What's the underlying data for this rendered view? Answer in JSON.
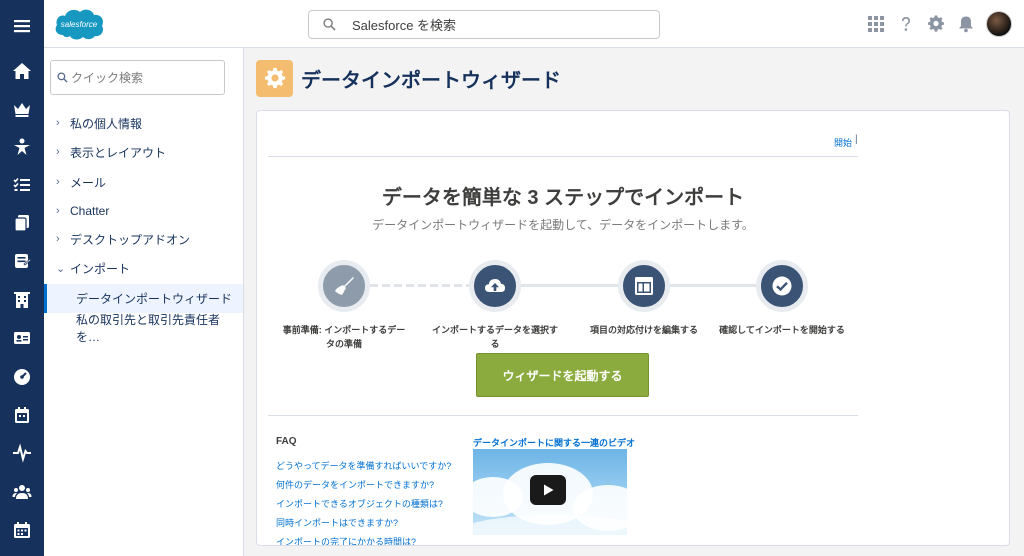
{
  "app": {
    "logo_text": "salesforce"
  },
  "rail": {
    "items": [
      "menu-icon",
      "home-icon",
      "crown-icon",
      "star-person-icon",
      "task-list-icon",
      "copy-icon",
      "contract-icon",
      "building-icon",
      "contact-card-icon",
      "dashboard-icon",
      "calendar-check-icon",
      "pulse-icon",
      "people-icon",
      "calendar-icon"
    ]
  },
  "search": {
    "placeholder": "Salesforce を検索"
  },
  "sidebar": {
    "quick_find_placeholder": "クイック検索",
    "items": [
      {
        "label": "私の個人情報",
        "expanded": false
      },
      {
        "label": "表示とレイアウト",
        "expanded": false
      },
      {
        "label": "メール",
        "expanded": false
      },
      {
        "label": "Chatter",
        "expanded": false
      },
      {
        "label": "デスクトップアドオン",
        "expanded": false
      },
      {
        "label": "インポート",
        "expanded": true
      }
    ],
    "sub_items": [
      {
        "label": "データインポートウィザード",
        "active": true
      },
      {
        "label": "私の取引先と取引先責任者を…",
        "active": false
      }
    ]
  },
  "page": {
    "title": "データインポートウィザード",
    "icon_color": "#f4bc6f"
  },
  "card": {
    "help_link": "開始",
    "hero_title": "データを簡単な 3 ステップでインポート",
    "hero_subtitle": "データインポートウィザードを起動して、データをインポートします。",
    "steps": [
      {
        "label": "事前準備: インポートするデータの準備",
        "icon": "broom-icon"
      },
      {
        "label": "インポートするデータを選択する",
        "icon": "cloud-upload-icon"
      },
      {
        "label": "項目の対応付けを編集する",
        "icon": "layout-icon"
      },
      {
        "label": "確認してインポートを開始する",
        "icon": "check-icon"
      }
    ],
    "launch_button": "ウィザードを起動する",
    "launch_button_color": "#8cab3e",
    "faq": {
      "title": "FAQ",
      "links": [
        "どうやってデータを準備すればいいですか?",
        "何件のデータをインポートできますか?",
        "インポートできるオブジェクトの種類は?",
        "同時インポートはできますか?",
        "インポートの完了にかかる時間は?"
      ]
    },
    "video": {
      "title": "データインポートに関する一連のビデオ"
    }
  },
  "colors": {
    "nav": "#16325c",
    "link": "#0070d2",
    "step": "#3b5374"
  }
}
